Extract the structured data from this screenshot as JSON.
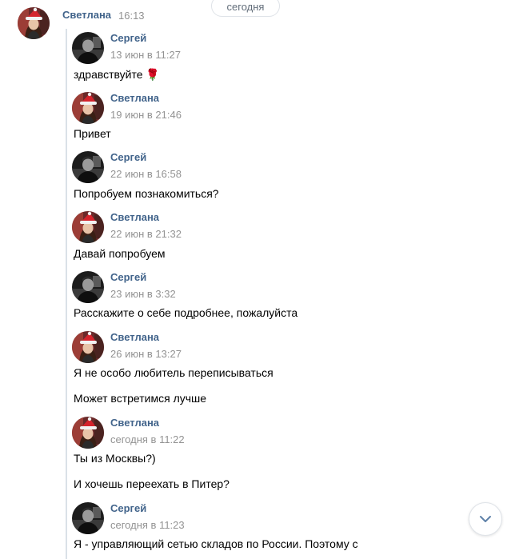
{
  "date_divider": "сегодня",
  "header": {
    "name": "Светлана",
    "time": "16:13"
  },
  "messages": [
    {
      "name": "Сергей",
      "time": "13 июн в 11:27",
      "texts": [
        "здравствуйте 🌹"
      ],
      "avatar": "male-avatar-icon"
    },
    {
      "name": "Светлана",
      "time": "19 июн в 21:46",
      "texts": [
        "Привет"
      ],
      "avatar": "female-avatar-icon"
    },
    {
      "name": "Сергей",
      "time": "22 июн в 16:58",
      "texts": [
        "Попробуем познакомиться?"
      ],
      "avatar": "male-avatar-icon"
    },
    {
      "name": "Светлана",
      "time": "22 июн в 21:32",
      "texts": [
        "Давай попробуем"
      ],
      "avatar": "female-avatar-icon"
    },
    {
      "name": "Сергей",
      "time": "23 июн в 3:32",
      "texts": [
        "Расскажите о себе подробнее, пожалуйста"
      ],
      "avatar": "male-avatar-icon"
    },
    {
      "name": "Светлана",
      "time": "26 июн в 13:27",
      "texts": [
        "Я не особо любитель переписываться",
        "Может встретимся лучше"
      ],
      "avatar": "female-avatar-icon"
    },
    {
      "name": "Светлана",
      "time": "сегодня в 11:22",
      "texts": [
        "Ты из Москвы?)",
        "И хочешь переехать в Питер?"
      ],
      "avatar": "female-avatar-icon"
    },
    {
      "name": "Сергей",
      "time": "сегодня в 11:23",
      "texts": [
        "Я - управляющий сетью складов по России. Поэтому с"
      ],
      "avatar": "male-avatar-icon"
    }
  ],
  "colors": {
    "name_link": "#42648b",
    "timestamp": "#939393",
    "forward_line": "#dae1e8"
  },
  "scroll_button_icon": "chevron-down-icon"
}
